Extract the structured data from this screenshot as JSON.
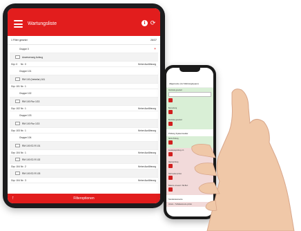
{
  "tablet": {
    "header_title": "Wartungsliste",
    "filter_text": "1 Filter gesetzt",
    "count_text": "26/37",
    "bottom_label": "Filteroptionen",
    "list": [
      {
        "kind": "group",
        "label": "Gruppe 0",
        "plus": "+"
      },
      {
        "kind": "item",
        "label": "Anwesenung Aufzug"
      },
      {
        "kind": "meta",
        "c1": "Grp: 0",
        "c2": "Nr.: 0",
        "c3": "Keine Ausführung"
      },
      {
        "kind": "group",
        "label": "Gruppe 101"
      },
      {
        "kind": "item",
        "label": "RM 100 (Verteiler) 161"
      },
      {
        "kind": "meta",
        "c1": "Grp: 101",
        "c2": "Nr.: 1",
        "c3": ""
      },
      {
        "kind": "group",
        "label": "Gruppe 102"
      },
      {
        "kind": "item",
        "label": "RM 100 Flur 1G3"
      },
      {
        "kind": "meta",
        "c1": "Grp: 102",
        "c2": "Nr.: 1",
        "c3": "Keine Ausführung"
      },
      {
        "kind": "group",
        "label": "Gruppe 103"
      },
      {
        "kind": "item",
        "label": "RM 100 Flur 1G3"
      },
      {
        "kind": "meta",
        "c1": "Grp: 103",
        "c2": "Nr.: 1",
        "c3": "Keine Ausführung"
      },
      {
        "kind": "group",
        "label": "Gruppe 104"
      },
      {
        "kind": "item",
        "label": "RM 100 E2-R 101"
      },
      {
        "kind": "meta",
        "c1": "Grp: 104",
        "c2": "Nr.: 1",
        "c3": "Keine Ausführung"
      },
      {
        "kind": "item",
        "label": "RM 100 E2-R 102"
      },
      {
        "kind": "meta",
        "c1": "Grp: 104",
        "c2": "Nr.: 2",
        "c3": "Keine Ausführung"
      },
      {
        "kind": "item",
        "label": "RM 100 E2-R 103"
      },
      {
        "kind": "meta",
        "c1": "Grp: 104",
        "c2": "Nr.: 3",
        "c3": "Keine Ausführung"
      }
    ]
  },
  "phone": {
    "head": "Allgemeine (zur Wartungstypen)",
    "sections": [
      {
        "tone": "green",
        "label": "Autozeile generiert",
        "field": true,
        "btn": true
      },
      {
        "tone": "green",
        "label": "Bemerkung",
        "field": false,
        "btn": true
      },
      {
        "tone": "green",
        "label": "Bestücke generiert",
        "field": false,
        "btn": true
      }
    ],
    "sep1": "Prüfung Systemmelder",
    "sections2": [
      {
        "tone": "green",
        "label": "Sicht-Prüfung",
        "btn": true
      },
      {
        "tone": "pink",
        "label": "Funktionsprüfung i.O.",
        "btn": true
      },
      {
        "tone": "pink",
        "label": "Alarmprüfung",
        "btn": true
      },
      {
        "tone": "pink",
        "label": "Störmelder prüfen",
        "btn": true
      },
      {
        "tone": "pink",
        "label": "Batterie erneuert / Stk.Bez.",
        "btn": true
      }
    ],
    "sep2": "Sonderelemente",
    "tail": "Verteil.- / Schaltelemente prüfen"
  },
  "colors": {
    "brand_red": "#e21d1d"
  }
}
